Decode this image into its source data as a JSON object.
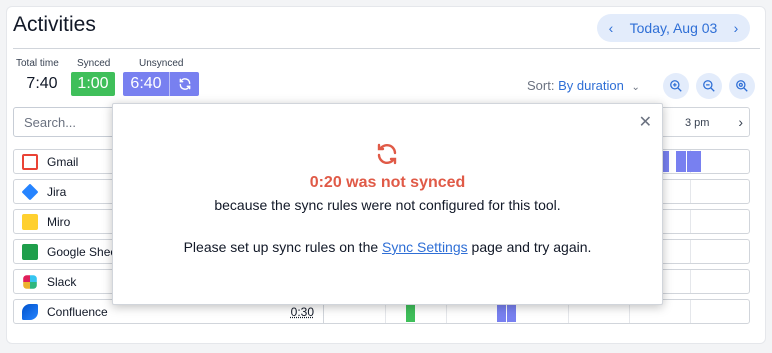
{
  "header": {
    "title": "Activities",
    "date_label": "Today,  Aug 03",
    "prev_icon": "chevron-left-icon",
    "next_icon": "chevron-right-icon"
  },
  "summary": {
    "total_label": "Total time",
    "total_value": "7:40",
    "synced_label": "Synced",
    "synced_value": "1:00",
    "unsynced_label": "Unsynced",
    "unsynced_value": "6:40",
    "synced_color": "#3fbf5a",
    "unsynced_color": "#7880f0"
  },
  "sort": {
    "prefix": "Sort:",
    "value": "By duration"
  },
  "search": {
    "placeholder": "Search..."
  },
  "timeline": {
    "tick_label": "3 pm"
  },
  "apps": [
    {
      "name": "Gmail",
      "duration": ""
    },
    {
      "name": "Jira",
      "duration": ""
    },
    {
      "name": "Miro",
      "duration": ""
    },
    {
      "name": "Google Sheets",
      "duration": ""
    },
    {
      "name": "Slack",
      "duration": ""
    },
    {
      "name": "Confluence",
      "duration": "0:30"
    }
  ],
  "dialog": {
    "heading": "0:20 was not synced",
    "reason": "because the sync rules were not configured for this tool.",
    "hint_before": "Please set up sync rules on the ",
    "hint_link": "Sync Settings",
    "hint_after": " page and try again.",
    "accent_color": "#e05a47"
  }
}
